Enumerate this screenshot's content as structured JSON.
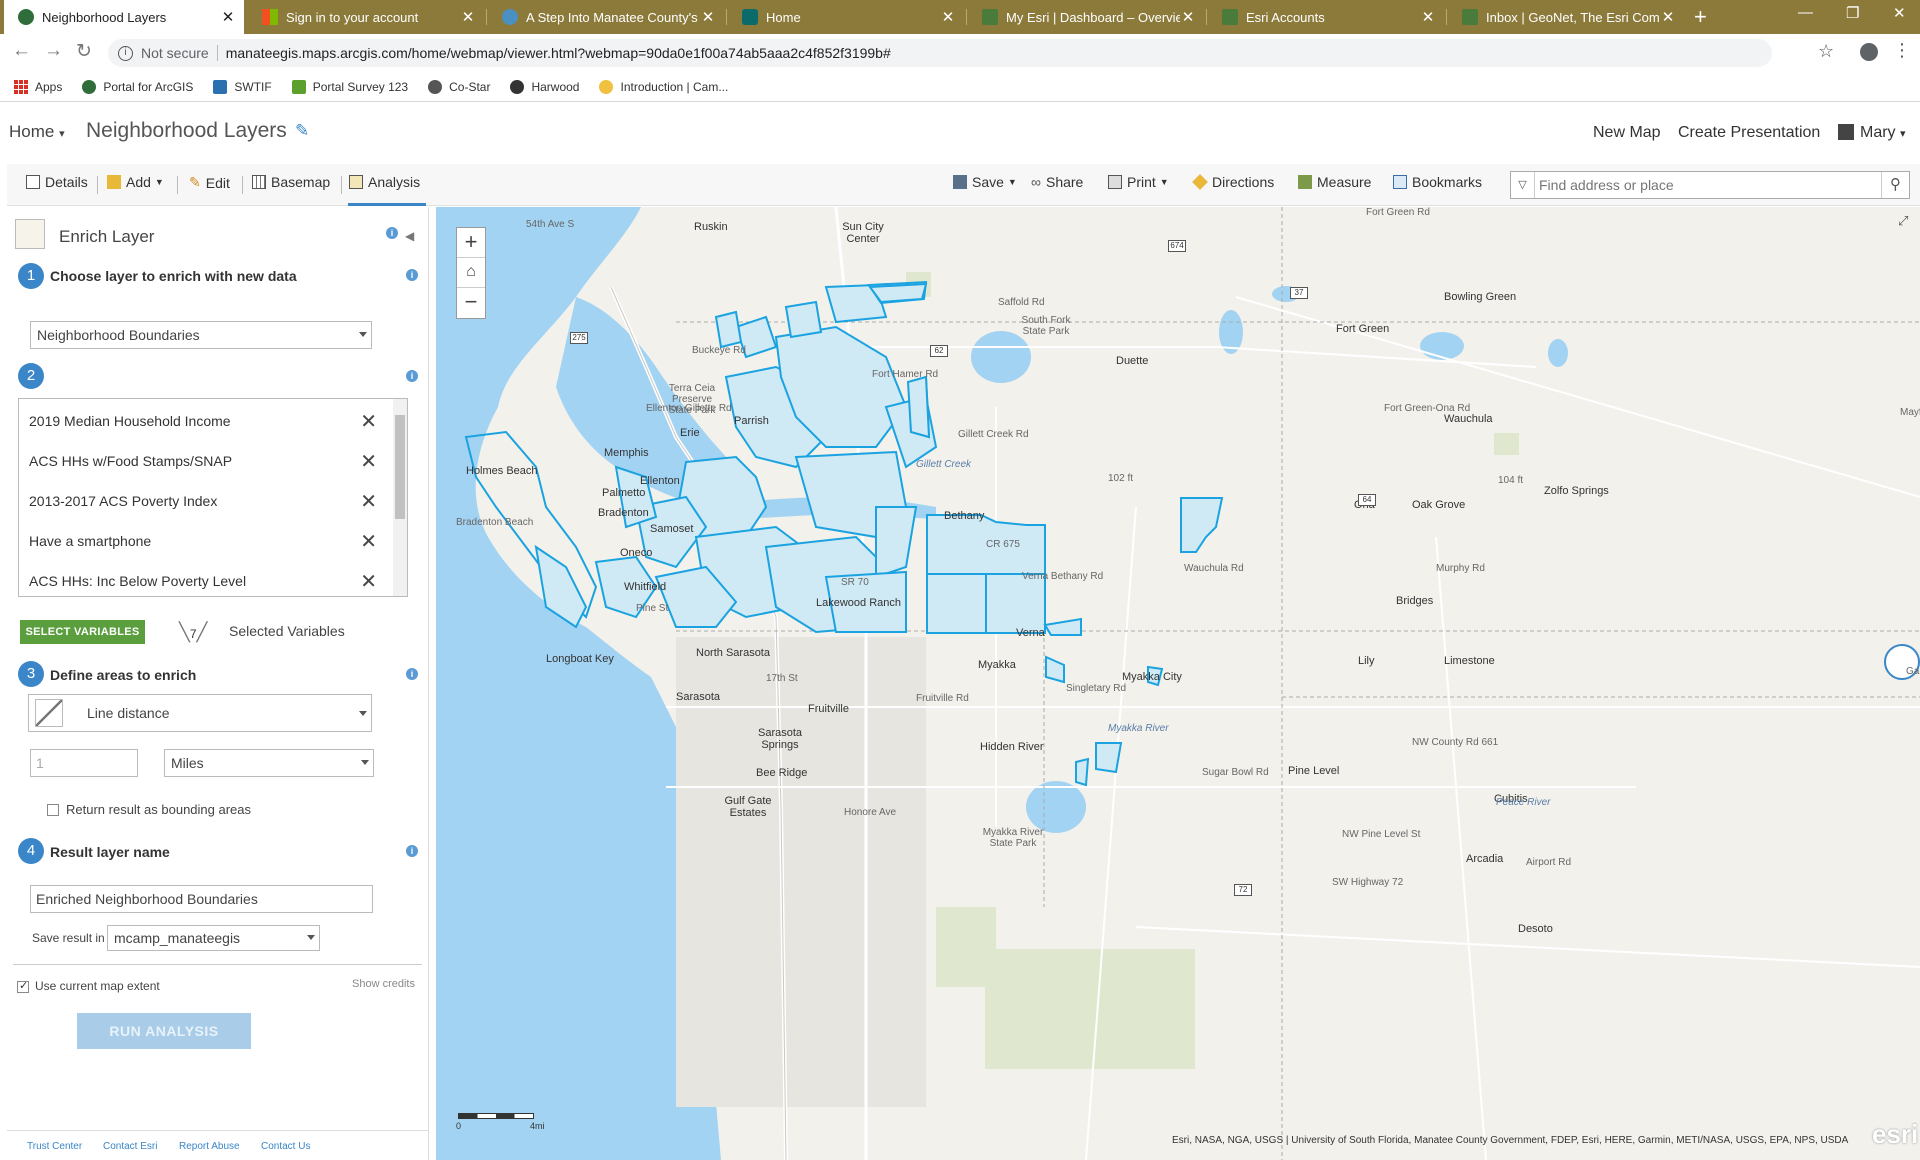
{
  "browser": {
    "tabs": [
      {
        "title": "Neighborhood Layers",
        "active": true
      },
      {
        "title": "Sign in to your account",
        "active": false
      },
      {
        "title": "A Step Into Manatee County's Pa",
        "active": false
      },
      {
        "title": "Home",
        "active": false
      },
      {
        "title": "My Esri | Dashboard – Overview",
        "active": false
      },
      {
        "title": "Esri Accounts",
        "active": false
      },
      {
        "title": "Inbox | GeoNet, The Esri Commu",
        "active": false
      }
    ],
    "security_label": "Not secure",
    "url": "manateegis.maps.arcgis.com/home/webmap/viewer.html?webmap=90da0e1f00a74ab5aaa2c4f852f3199b#",
    "bookmarks": [
      "Apps",
      "Portal for ArcGIS",
      "SWTIF",
      "Portal Survey 123",
      "Co-Star",
      "Harwood",
      "Introduction | Cam..."
    ]
  },
  "header": {
    "home_label": "Home",
    "map_title": "Neighborhood Layers",
    "new_map": "New Map",
    "create_presentation": "Create Presentation",
    "user_name": "Mary"
  },
  "toolbar": {
    "details": "Details",
    "add": "Add",
    "edit": "Edit",
    "basemap": "Basemap",
    "analysis": "Analysis",
    "save": "Save",
    "share": "Share",
    "print": "Print",
    "directions": "Directions",
    "measure": "Measure",
    "bookmarks": "Bookmarks",
    "search_placeholder": "Find address or place"
  },
  "panel": {
    "title": "Enrich Layer",
    "step1_num": "1",
    "step1_label": "Choose layer to enrich with new data",
    "layer_value": "Neighborhood Boundaries",
    "step2_num": "2",
    "variables": [
      "2019 Median Household Income",
      "ACS HHs w/Food Stamps/SNAP",
      "2013-2017 ACS Poverty Index",
      "Have a smartphone",
      "ACS HHs: Inc Below Poverty Level"
    ],
    "select_variables": "SELECT VARIABLES",
    "selected_count": "7",
    "selected_label": "Selected Variables",
    "step3_num": "3",
    "step3_label": "Define areas to enrich",
    "distance_type": "Line distance",
    "distance_value": "1",
    "distance_unit": "Miles",
    "bounding_label": "Return result as bounding areas",
    "step4_num": "4",
    "step4_label": "Result layer name",
    "result_name": "Enriched Neighborhood Boundaries",
    "save_in_label": "Save result in",
    "save_in_value": "mcamp_manateegis",
    "use_extent_label": "Use current map extent",
    "show_credits": "Show credits",
    "run_analysis": "RUN ANALYSIS",
    "footer_links": [
      "Trust Center",
      "Contact Esri",
      "Report Abuse",
      "Contact Us"
    ]
  },
  "map": {
    "places": [
      "54th Ave S",
      "Ruskin",
      "Sun City Center",
      "Buckeye Rd",
      "Terra Ceia Preserve State Park",
      "Erie",
      "Parrish",
      "Memphis",
      "Ellenton",
      "Palmetto",
      "Holmes Beach",
      "Bradenton",
      "Oneco",
      "Whitfield",
      "Samoset",
      "Longboat Key",
      "North Sarasota",
      "17th St",
      "Sarasota",
      "Fruitville",
      "Fruitville Rd",
      "Sarasota Springs",
      "Bee Ridge",
      "Gulf Gate Estates",
      "Duette",
      "Fort Green",
      "Bowling Green",
      "South Fork State Park",
      "Wauchula",
      "Ona",
      "Oak Grove",
      "Zolfo Springs",
      "Bethany",
      "Myakka",
      "Verna",
      "Myakka City",
      "Singletary Rd",
      "Hidden River",
      "Myakka River State Park",
      "Bridges",
      "Lily",
      "Limestone",
      "Pine Level",
      "Cubitis",
      "Arcadia",
      "SW Highway 72",
      "Desoto",
      "NW Pine Level St",
      "Gillett Creek",
      "Myakka River",
      "Peace River",
      "Saffold Rd",
      "Fort Green Rd",
      "Fort Green-Ona Rd",
      "Wauchula Rd",
      "Verna Bethany Rd",
      "Murphy Rd",
      "Sugar Bowl Rd",
      "Honore Ave",
      "NW County Rd 661",
      "Airport Rd",
      "Lakewood Ranch",
      "Fort Hamer Rd",
      "102 ft",
      "104 ft",
      "Gillett Creek Rd",
      "Bradenton Beach",
      "Ellenton Gillette Rd",
      "SR 70",
      "CR 675",
      "Pine St",
      "Mayflower",
      "Ganoe"
    ],
    "shields": [
      "674",
      "37",
      "275",
      "62",
      "64",
      "72",
      "675"
    ],
    "scale_label": "4mi",
    "scale_zero": "0",
    "attribution": "Esri, NASA, NGA, USGS | University of South Florida, Manatee County Government, FDEP, Esri, HERE, Garmin, METI/NASA, USGS, EPA, NPS, USDA",
    "esri_logo": "esri",
    "neighborhood_stroke": "#1aa3e0",
    "neighborhood_fill": "#cfe9f5",
    "water": "#a3d3f2"
  }
}
